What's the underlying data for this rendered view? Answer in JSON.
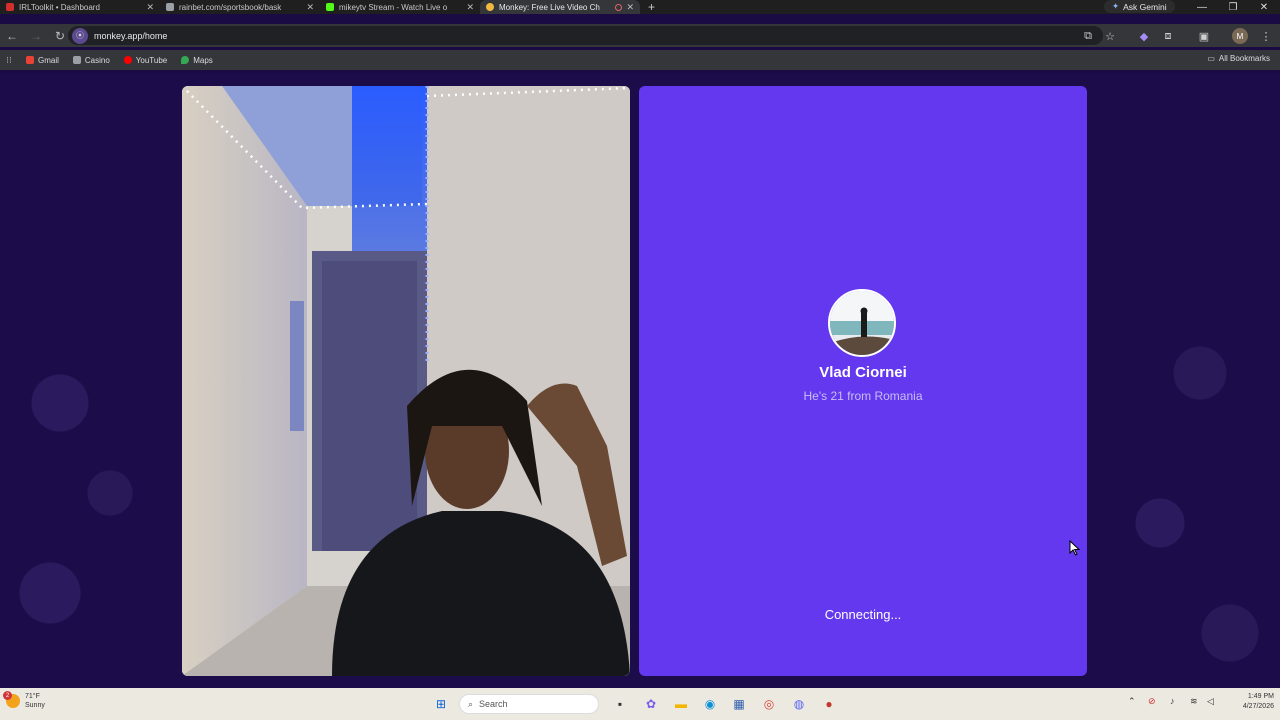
{
  "tabs": [
    {
      "title": "IRLToolkit • Dashboard",
      "favicon_color": "#d32f2f",
      "active": false
    },
    {
      "title": "rainbet.com/sportsbook/bask",
      "favicon_color": "#9aa0a6",
      "active": false
    },
    {
      "title": "mikeytv Stream - Watch Live o",
      "favicon_color": "#53fc18",
      "active": false
    },
    {
      "title": "Monkey: Free Live Video Ch",
      "favicon_color": "#f0b840",
      "active": true
    }
  ],
  "toolbar": {
    "ask_gemini": "Ask Gemini",
    "url": "monkey.app/home",
    "profile_initial": "M"
  },
  "bookmarks": [
    {
      "label": "Gmail",
      "color": "#ea4335"
    },
    {
      "label": "Casino",
      "color": "#9aa0a6"
    },
    {
      "label": "YouTube",
      "color": "#ff0000"
    },
    {
      "label": "Maps",
      "color": "#34a853"
    }
  ],
  "all_bookmarks": "All Bookmarks",
  "match": {
    "name": "Vlad Ciornei",
    "subtitle": "He's 21 from Romania",
    "status": "Connecting..."
  },
  "colors": {
    "page_bg": "#1c0d4a",
    "match_panel": "#6338ee"
  },
  "taskbar": {
    "temperature": "71°F",
    "weather": "Sunny",
    "weather_badge": "2",
    "search_placeholder": "Search",
    "time": "1:49 PM",
    "date": "4/27/2026"
  }
}
